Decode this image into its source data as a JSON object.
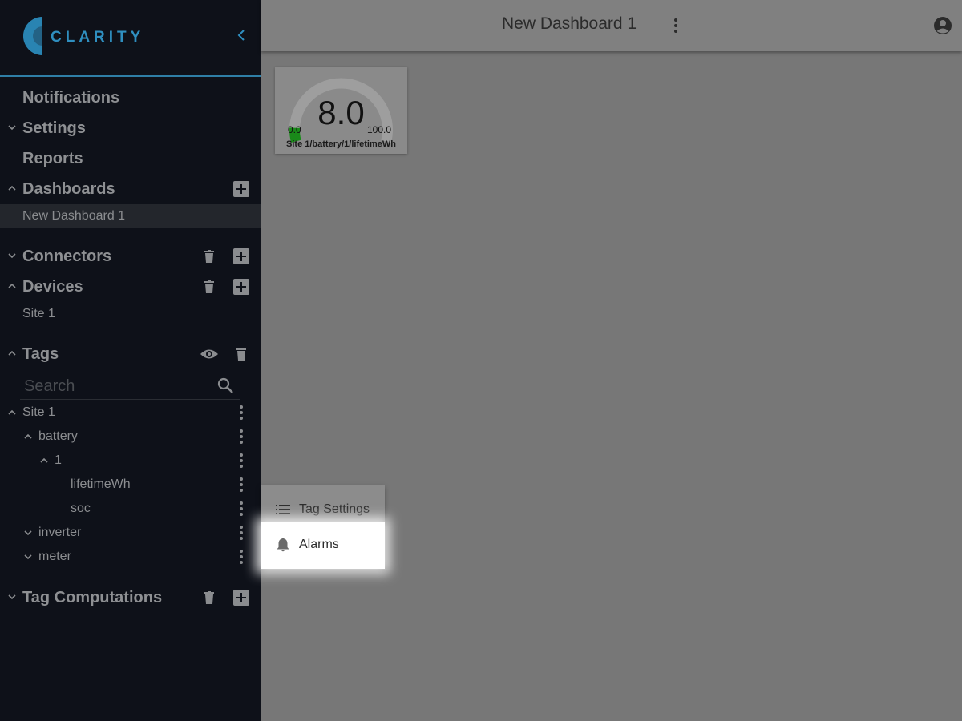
{
  "sidebar": {
    "logo_text": "CLARITY",
    "collapse_icon": "chevron-left-icon",
    "sections": {
      "notifications": "Notifications",
      "settings": "Settings",
      "reports": "Reports",
      "dashboards": "Dashboards",
      "connectors": "Connectors",
      "devices": "Devices",
      "tags": "Tags",
      "tag_computations": "Tag Computations"
    },
    "dashboards": [
      "New Dashboard 1"
    ],
    "devices": [
      "Site 1"
    ],
    "search": {
      "placeholder": "Search",
      "value": ""
    },
    "tag_tree": {
      "site": "Site 1",
      "battery": "battery",
      "battery_1": "1",
      "lifetimeWh": "lifetimeWh",
      "soc": "soc",
      "inverter": "inverter",
      "meter": "meter"
    }
  },
  "topbar": {
    "title": "New Dashboard 1",
    "menu_icon": "more-vert-icon",
    "user_icon": "account-circle-icon"
  },
  "gauge": {
    "value": "8.0",
    "min": "0.0",
    "max": "100.0",
    "label": "Site 1/battery/1/lifetimeWh",
    "fraction": 0.08,
    "fill_color": "#1a8a1a"
  },
  "context_menu": {
    "items": [
      {
        "label": "Tag Settings",
        "icon": "list-icon"
      },
      {
        "label": "Alarms",
        "icon": "bell-icon"
      }
    ]
  },
  "colors": {
    "sidebar_bg": "#0e1119",
    "accent": "#2f8fc0",
    "overlay_bg": "#777777"
  }
}
